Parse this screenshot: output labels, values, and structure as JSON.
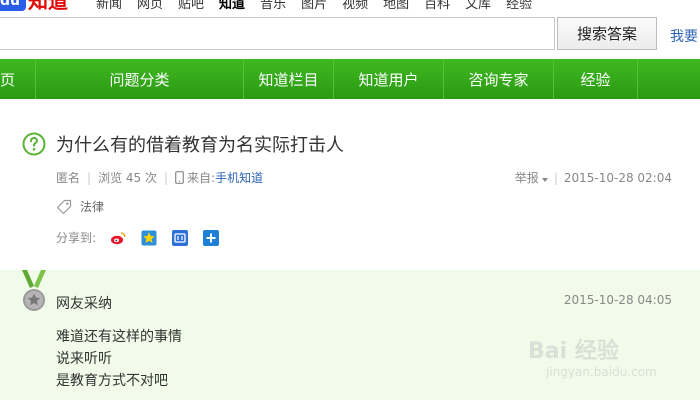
{
  "header": {
    "logo_du": "du",
    "logo_text": "知道",
    "topnav": [
      "新闻",
      "网页",
      "贴吧",
      "知道",
      "音乐",
      "图片",
      "视频",
      "地图",
      "百科",
      "文库",
      "经验"
    ],
    "active_topnav": "知道",
    "search_value": "",
    "search_button": "搜索答案",
    "ask_link": "我要"
  },
  "greennav": {
    "items": [
      "页",
      "问题分类",
      "知道栏目",
      "知道用户",
      "咨询专家",
      "经验"
    ]
  },
  "question": {
    "title": "为什么有的借着教育为名实际打击人",
    "author": "匿名",
    "views": "浏览 45 次",
    "source_label": "来自:",
    "source_link": "手机知道",
    "report": "举报",
    "time": "2015-10-28 02:04",
    "tag": "法律",
    "share_label": "分享到:",
    "share_targets": [
      "weibo-icon",
      "qzone-icon",
      "tieba-icon",
      "more-share-icon"
    ]
  },
  "answer": {
    "user": "网友采纳",
    "time": "2015-10-28 04:05",
    "lines": [
      "难道还有这样的事情",
      "说来听听",
      "是教育方式不对吧"
    ]
  },
  "watermark": {
    "line1": "Bai 经验",
    "line2": "jingyan.baidu.com"
  },
  "colors": {
    "nav_green": "#33a91a",
    "link_blue": "#2d64b3",
    "answer_bg": "#f0fbe9",
    "question_icon": "#5ab332"
  }
}
